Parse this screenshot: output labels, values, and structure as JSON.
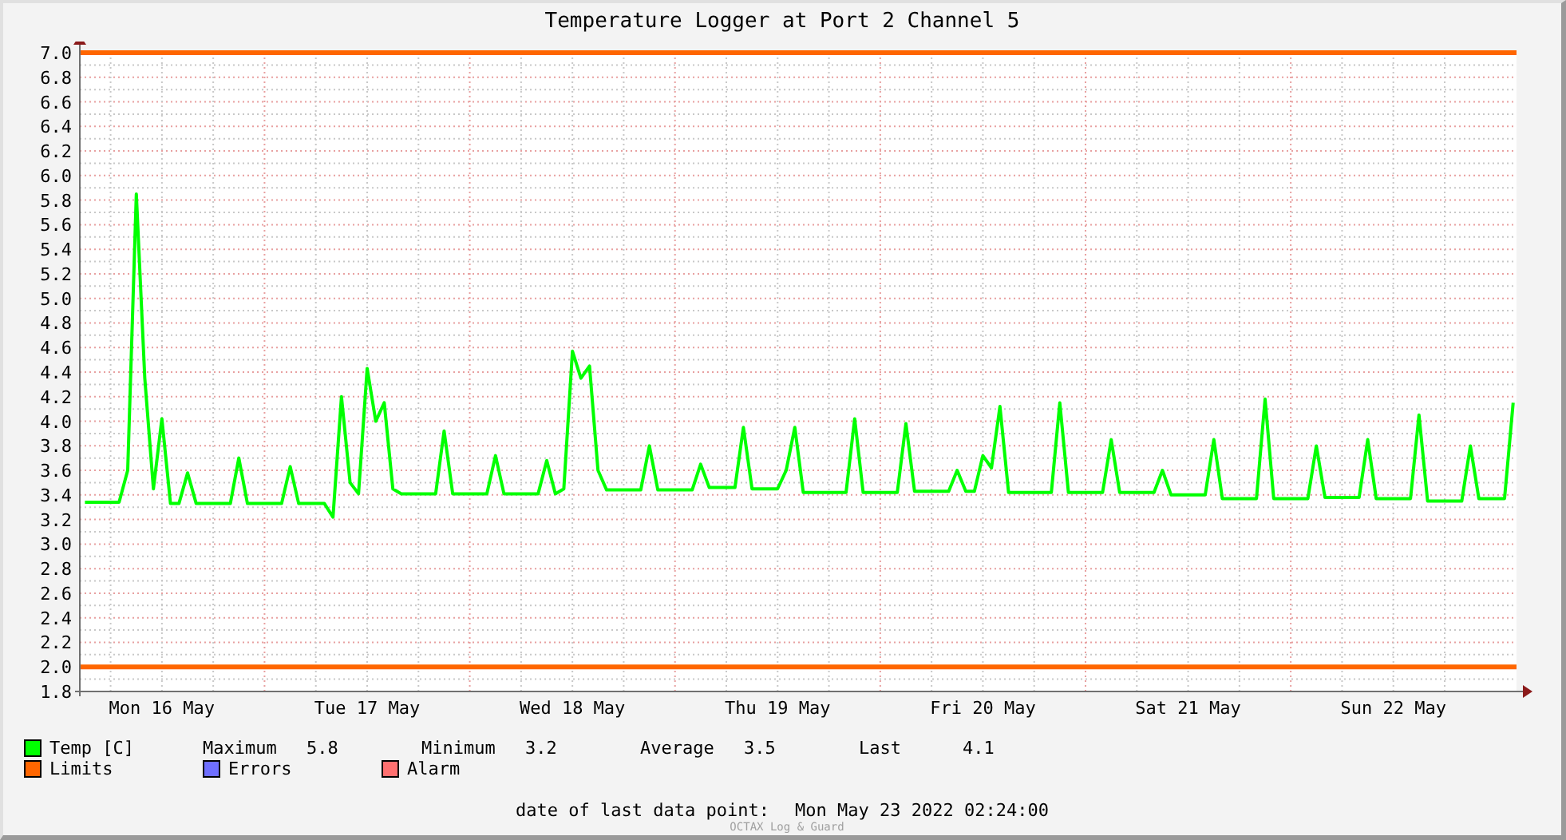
{
  "title": "Temperature Logger at Port 2 Channel 5",
  "chart_data": {
    "type": "line",
    "ylim": [
      1.8,
      7.0
    ],
    "yticks": [
      {
        "value": 1.8,
        "label": "1.8"
      },
      {
        "value": 2.0,
        "label": "2.0"
      },
      {
        "value": 2.2,
        "label": "2.2"
      },
      {
        "value": 2.4,
        "label": "2.4"
      },
      {
        "value": 2.6,
        "label": "2.6"
      },
      {
        "value": 2.8,
        "label": "2.8"
      },
      {
        "value": 3.0,
        "label": "3.0"
      },
      {
        "value": 3.2,
        "label": "3.2"
      },
      {
        "value": 3.4,
        "label": "3.4"
      },
      {
        "value": 3.6,
        "label": "3.6"
      },
      {
        "value": 3.8,
        "label": "3.8"
      },
      {
        "value": 4.0,
        "label": "4.0"
      },
      {
        "value": 4.2,
        "label": "4.2"
      },
      {
        "value": 4.4,
        "label": "4.4"
      },
      {
        "value": 4.6,
        "label": "4.6"
      },
      {
        "value": 4.8,
        "label": "4.8"
      },
      {
        "value": 5.0,
        "label": "5.0"
      },
      {
        "value": 5.2,
        "label": "5.2"
      },
      {
        "value": 5.4,
        "label": "5.4"
      },
      {
        "value": 5.6,
        "label": "5.6"
      },
      {
        "value": 5.8,
        "label": "5.8"
      },
      {
        "value": 6.0,
        "label": "6.0"
      },
      {
        "value": 6.2,
        "label": "6.2"
      },
      {
        "value": 6.4,
        "label": "6.4"
      },
      {
        "value": 6.6,
        "label": "6.6"
      },
      {
        "value": 6.8,
        "label": "6.8"
      },
      {
        "value": 7.0,
        "label": "7.0"
      }
    ],
    "categories": [
      null,
      null,
      null,
      null,
      null,
      null,
      null,
      null,
      null,
      "Mon 16 May",
      null,
      null,
      null,
      null,
      null,
      null,
      null,
      null,
      null,
      null,
      null,
      null,
      null,
      null,
      null,
      null,
      null,
      null,
      null,
      null,
      null,
      null,
      null,
      "Tue 17 May",
      null,
      null,
      null,
      null,
      null,
      null,
      null,
      null,
      null,
      null,
      null,
      null,
      null,
      null,
      null,
      null,
      null,
      null,
      null,
      null,
      null,
      null,
      null,
      "Wed 18 May",
      null,
      null,
      null,
      null,
      null,
      null,
      null,
      null,
      null,
      null,
      null,
      null,
      null,
      null,
      null,
      null,
      null,
      null,
      null,
      null,
      null,
      null,
      null,
      "Thu 19 May",
      null,
      null,
      null,
      null,
      null,
      null,
      null,
      null,
      null,
      null,
      null,
      null,
      null,
      null,
      null,
      null,
      null,
      null,
      null,
      null,
      null,
      null,
      null,
      "Fri 20 May",
      null,
      null,
      null,
      null,
      null,
      null,
      null,
      null,
      null,
      null,
      null,
      null,
      null,
      null,
      null,
      null,
      null,
      null,
      null,
      null,
      null,
      null,
      null,
      "Sat 21 May",
      null,
      null,
      null,
      null,
      null,
      null,
      null,
      null,
      null,
      null,
      null,
      null,
      null,
      null,
      null,
      null,
      null,
      null,
      null,
      null,
      null,
      null,
      null,
      "Sun 22 May",
      null,
      null,
      null,
      null,
      null,
      null,
      null,
      null,
      null,
      null,
      null,
      null,
      null,
      null
    ],
    "series": [
      {
        "name": "Temp [C]",
        "color": "#00ff00",
        "values": [
          3.34,
          3.34,
          3.34,
          3.34,
          3.34,
          3.6,
          5.85,
          4.35,
          3.45,
          4.02,
          3.33,
          3.33,
          3.58,
          3.33,
          3.33,
          3.33,
          3.33,
          3.33,
          3.7,
          3.33,
          3.33,
          3.33,
          3.33,
          3.33,
          3.63,
          3.33,
          3.33,
          3.33,
          3.33,
          3.22,
          4.2,
          3.5,
          3.41,
          4.43,
          4.0,
          4.15,
          3.45,
          3.41,
          3.41,
          3.41,
          3.41,
          3.41,
          3.92,
          3.41,
          3.41,
          3.41,
          3.41,
          3.41,
          3.72,
          3.41,
          3.41,
          3.41,
          3.41,
          3.41,
          3.68,
          3.41,
          3.45,
          4.57,
          4.35,
          4.45,
          3.6,
          3.44,
          3.44,
          3.44,
          3.44,
          3.44,
          3.8,
          3.44,
          3.44,
          3.44,
          3.44,
          3.44,
          3.65,
          3.46,
          3.46,
          3.46,
          3.46,
          3.95,
          3.45,
          3.45,
          3.45,
          3.45,
          3.6,
          3.95,
          3.42,
          3.42,
          3.42,
          3.42,
          3.42,
          3.42,
          4.02,
          3.42,
          3.42,
          3.42,
          3.42,
          3.42,
          3.98,
          3.43,
          3.43,
          3.43,
          3.43,
          3.43,
          3.6,
          3.43,
          3.43,
          3.72,
          3.62,
          4.12,
          3.42,
          3.42,
          3.42,
          3.42,
          3.42,
          3.42,
          4.15,
          3.42,
          3.42,
          3.42,
          3.42,
          3.42,
          3.85,
          3.42,
          3.42,
          3.42,
          3.42,
          3.42,
          3.6,
          3.4,
          3.4,
          3.4,
          3.4,
          3.4,
          3.85,
          3.37,
          3.37,
          3.37,
          3.37,
          3.37,
          4.18,
          3.37,
          3.37,
          3.37,
          3.37,
          3.37,
          3.8,
          3.38,
          3.38,
          3.38,
          3.38,
          3.38,
          3.85,
          3.37,
          3.37,
          3.37,
          3.37,
          3.37,
          4.05,
          3.35,
          3.35,
          3.35,
          3.35,
          3.35,
          3.8,
          3.37,
          3.37,
          3.37,
          3.37,
          4.15
        ]
      }
    ],
    "ref_lines": [
      {
        "axis": "y",
        "value": 7.0
      },
      {
        "axis": "y",
        "value": 2.0
      }
    ],
    "grid": true
  },
  "legend": [
    {
      "label": "Limits",
      "color": "#ff6600"
    },
    {
      "label": "Errors",
      "color": "#6f6fff"
    },
    {
      "label": "Alarm",
      "color": "#ff7070"
    }
  ],
  "stats": [
    {
      "label": "Maximum",
      "value": "5.8"
    },
    {
      "label": "Minimum",
      "value": "3.2"
    },
    {
      "label": "Average",
      "value": "3.5"
    },
    {
      "label": "Last",
      "value": "4.1"
    }
  ],
  "last_data_point": {
    "label": "date of last data point:",
    "value": "Mon May 23 2022 02:24:00"
  },
  "footer_credit": "OCTAX Log & Guard"
}
